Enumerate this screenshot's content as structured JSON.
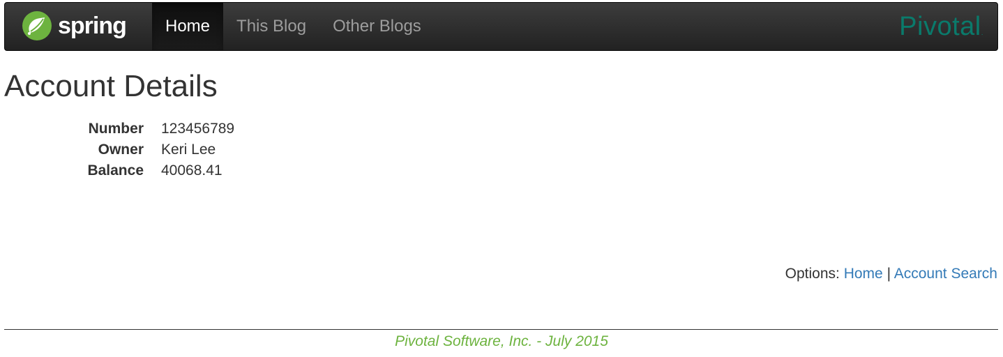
{
  "navbar": {
    "brand_text": "spring",
    "brand_icon": "spring-leaf-icon",
    "items": [
      {
        "label": "Home",
        "active": true
      },
      {
        "label": "This Blog",
        "active": false
      },
      {
        "label": "Other Blogs",
        "active": false
      }
    ],
    "right_logo_text": "Pivotal",
    "right_logo_mark": "."
  },
  "page": {
    "title": "Account Details"
  },
  "account": {
    "fields": [
      {
        "label": "Number",
        "value": "123456789"
      },
      {
        "label": "Owner",
        "value": "Keri Lee"
      },
      {
        "label": "Balance",
        "value": "40068.41"
      }
    ]
  },
  "options": {
    "prefix": "Options:",
    "links": [
      "Home",
      "Account Search"
    ],
    "separator": "|"
  },
  "footer": {
    "text": "Pivotal Software, Inc. - July 2015"
  },
  "colors": {
    "navbar_bg": "#222222",
    "spring_green": "#6db33f",
    "pivotal_teal": "#0a7a6b",
    "link_blue": "#337ab7"
  }
}
